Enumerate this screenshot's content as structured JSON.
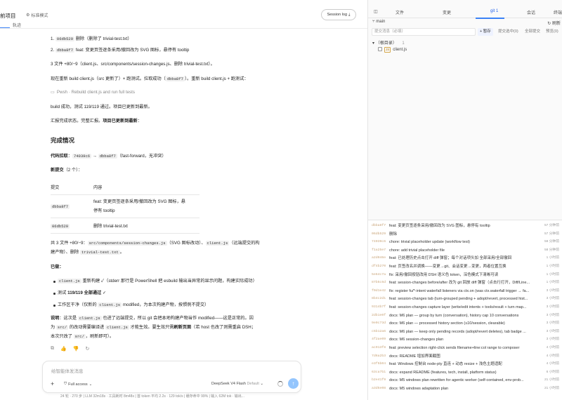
{
  "window": {
    "controls": [
      "—",
      "□",
      "✕"
    ]
  },
  "header": {
    "project_title": "前项目",
    "mode_label": "标准模式",
    "session_log": "Session log",
    "trace_tab": "轨迹"
  },
  "chat": {
    "commits_list": [
      {
        "num": "1.",
        "hash": "06db529",
        "text": "删除（删除了 trivial-test.txt）"
      },
      {
        "num": "2.",
        "hash": "dbba8f7",
        "text": "feat: 变更页签逐条采用/撤回改为 SVG 图标，悬停有 tooltip"
      }
    ],
    "files_line": "3 文件 +80/−9（client.js、src/components/session-changes.js、删除 trivial-test.txt）。",
    "rebuild_pre": "现在重新 build client.js（src 更新了）+ 跑测试。拉取成功（",
    "rebuild_hash": "dbba8f7",
    "rebuild_post": "）。重新 build client.js + 跑测试：",
    "cmd_label": "Pwsh · Rebuild client.js and run full tests",
    "build_result": "build 成功，测试 119/119 通过。项目已更新到最新。",
    "report_pre": "汇报完成状态。完整汇报。",
    "report_bold": "项目已更新到最新",
    "report_post": "：",
    "section_title": "完成情况",
    "pull_label": "代码拉取",
    "pull_from": "74039c6",
    "pull_arrow": "→",
    "pull_to": "dbba8f7",
    "pull_note": "（fast-forward，无冲突）",
    "new_commits_label": "新提交",
    "new_commits_count": "（2 个）：",
    "table": {
      "headers": [
        "提交",
        "内容"
      ],
      "rows": [
        {
          "hash": "dbba8f7",
          "content_line1": "feat: 变更页签逐条采用/撤回改为 SVG 图标，悬",
          "content_line2": "停有 tooltip"
        },
        {
          "hash": "06db529",
          "content_line1": "删除 trivial-test.txt",
          "content_line2": ""
        }
      ]
    },
    "summary_pre": "共 3 文件 +80/−9：",
    "summary_code1": "src/components/session-changes.js",
    "summary_mid1": "（SVG 图标改动）、",
    "summary_code2": "client.js",
    "summary_mid2": "（远端提交的构",
    "summary_line2_pre": "建产物）、删除",
    "summary_code3": "trivial-test.txt",
    "summary_line2_post": "。",
    "done_label": "已做：",
    "bullets": [
      {
        "code": "client.js",
        "text": "重新构建 ✓（stderr 那行是 PowerShell 把 esbuild 输出当异常的显示问题，构建实际成功）"
      },
      {
        "pre": "测试 ",
        "bold": "119/119 全部通过",
        "post": " ✓"
      },
      {
        "pre": "工作区干净（仅新的 ",
        "code": "client.js",
        "post": " modified，为本次构建产物，按惯例不提交）"
      }
    ],
    "note_label": "说明",
    "note_p1": "：这次是",
    "note_code1": "client.js",
    "note_p2": "也进了远端提交，所以 git 会把本地构建产物当作 modified——这是正常的。因",
    "note_p3": "为",
    "note_code2": "src/",
    "note_p4": "的改动需要编译进",
    "note_code3": "client.js",
    "note_p5": "才能生效。要生效只需",
    "note_bold": "刷新页面",
    "note_p6": "（若 host 也改了则需重启 DSH；",
    "note_p7": "本次只改了",
    "note_code4": "src/",
    "note_p8": "，刷新即可）。"
  },
  "composer": {
    "placeholder": "给智能体发消息",
    "plus": "+",
    "access_label": "Full access",
    "model_name": "DeepSeek V4 Flash",
    "model_variant": "Default",
    "send": "↑"
  },
  "statusbar": {
    "text": "24 轮 · 270 步 | LLM 32m18s · 工具耗时 8m48s | 首 token 平均 2.2s · 129 tok/s | 缓存命中 99% | 输入 62M tok · 输出..."
  },
  "right": {
    "tabs": [
      "文件",
      "变更",
      "git 1",
      "会话",
      "终端"
    ],
    "branch": "main",
    "refresh": "刷新",
    "commit_placeholder": "提交消息（必填）",
    "commit_buttons": [
      "+ 暂存",
      "提交选中(0)",
      "全部提交",
      "预览(0)"
    ],
    "tree": {
      "root": "（根目录）",
      "root_count": "1",
      "file": "client.js",
      "file_badge": "JS"
    },
    "history": [
      {
        "hash": "dbba8f7",
        "msg": "feat: 变更页签逐条采用/撤回改为 SVG 图标，悬停有 tooltip",
        "time": "57 分钟前"
      },
      {
        "hash": "06db529",
        "msg": "删除",
        "time": "57 分钟前"
      },
      {
        "hash": "74039c6",
        "msg": "chore: trivial placeholder update (workflow test)",
        "time": "58 分钟前"
      },
      {
        "hash": "f1a25e7",
        "msg": "chore: add trivial placeholder file",
        "time": "58 分钟前"
      },
      {
        "hash": "a2d046e",
        "msg": "feat: 已处理历史点击打开 diff 弹窗；每个对话项头加 全部采用/全部撤回",
        "time": "1 小时前"
      },
      {
        "hash": "df4b270",
        "msg": "feat: 页签改名并调换——变更→git、会话变更→变更，两者位置互换",
        "time": "1 小时前"
      },
      {
        "hash": "5e64c7a",
        "msg": "fix: 采用/撤回按钮改用 DSH 语义色 token，深色模式下清晰可读",
        "time": "1 小时前"
      },
      {
        "hash": "87b5c6d",
        "msg": "feat: session-changes before/after 改为 git 回放 diff 弹窗（点击行打开，Diff/Line...",
        "time": "1 小时前"
      },
      {
        "hash": "f0d1e42",
        "msg": "fix: register fu/*-intent waterfall listeners via ctx.on (was ctx.waterfall trigger → fa...",
        "time": "3 小时前"
      },
      {
        "hash": "8b4c2d1",
        "msg": "feat: session-changes tab (turn-grouped pending + adopt/revert, processed hist...",
        "time": "3 小时前"
      },
      {
        "hash": "9314b7f",
        "msg": "feat: session-changes capture layer (write/edit intents + tools/result + turn map...",
        "time": "3 小时前"
      },
      {
        "hash": "2db1e0f",
        "msg": "docs: M6 plan — group by turn (conversation), history cap 10 conversations",
        "time": "3 小时前"
      },
      {
        "hash": "9e0c73d",
        "msg": "docs: M6 plan — processed history section (≤10/session, clearable)",
        "time": "3 小时前"
      },
      {
        "hash": "c5b12a6",
        "msg": "docs: M6 plan — keep only pending records (adopt/revert deletes), tab badge ...",
        "time": "3 小时前"
      },
      {
        "hash": "4f2ae09",
        "msg": "docs: M6 session-changes plan",
        "time": "3 小时前"
      },
      {
        "hash": "ac913f8",
        "msg": "feat: preview selection right-click sends filename+line:col range to composer",
        "time": "4 小时前"
      },
      {
        "hash": "7d6a2b3",
        "msg": "docs: README 增加界面截图",
        "time": "4 小时前"
      },
      {
        "hash": "e3f5b04",
        "msg": "feat: Windows 控制台 node-pty 直连 + 动态 resize + 浅色主题适配",
        "time": "4 小时前"
      },
      {
        "hash": "63ca7b1",
        "msg": "docs: expand README (features, tech, install, platform status)",
        "time": "6 小时前"
      },
      {
        "hash": "b2e41f9",
        "msg": "docs: M5 windows plan rewritten for agentic worker (self-contained, env-prob...",
        "time": "21 小时前"
      },
      {
        "hash": "a3d5e08",
        "msg": "docs: M5 windows adaptation plan",
        "time": "21 小时前"
      }
    ]
  }
}
